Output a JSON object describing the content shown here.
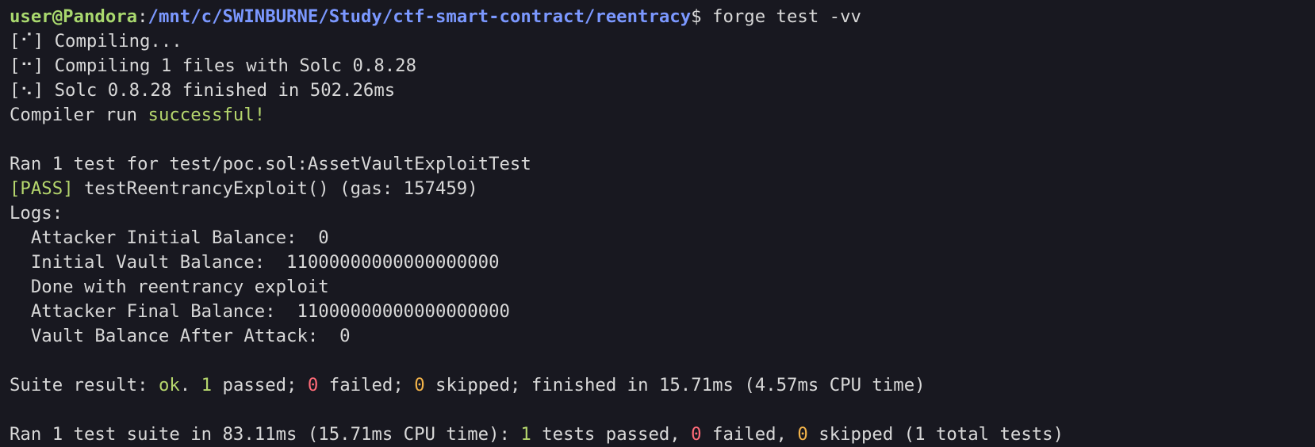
{
  "prompt": {
    "user": "user@Pandora",
    "sep": ":",
    "path": "/mnt/c/SWINBURNE/Study/ctf-smart-contract/reentracy",
    "symbol": "$",
    "command": " forge test -vv"
  },
  "compile": {
    "spin1": "[⠊]",
    "text1": " Compiling...",
    "spin2": "[⠒]",
    "text2": " Compiling 1 files with Solc 0.8.28",
    "spin3": "[⠢]",
    "text3": " Solc 0.8.28 finished in 502.26ms",
    "success_prefix": "Compiler run ",
    "success_word": "successful!"
  },
  "test": {
    "ran_line": "Ran 1 test for test/poc.sol:AssetVaultExploitTest",
    "pass_tag": "[PASS]",
    "pass_text": " testReentrancyExploit() (gas: 157459)",
    "logs_label": "Logs:",
    "logs": [
      "  Attacker Initial Balance:  0",
      "  Initial Vault Balance:  11000000000000000000",
      "  Done with reentrancy exploit",
      "  Attacker Final Balance:  11000000000000000000",
      "  Vault Balance After Attack:  0"
    ]
  },
  "suite": {
    "prefix": "Suite result: ",
    "ok": "ok",
    "dot": ". ",
    "passed_num": "1",
    "passed_text": " passed; ",
    "failed_num": "0",
    "failed_text": " failed; ",
    "skipped_num": "0",
    "skipped_text": " skipped; finished in 15.71ms (4.57ms CPU time)"
  },
  "summary": {
    "prefix": "Ran 1 test suite in 83.11ms (15.71ms CPU time): ",
    "passed_num": "1",
    "passed_text": " tests passed, ",
    "failed_num": "0",
    "failed_text": " failed, ",
    "skipped_num": "0",
    "skipped_text": " skipped (1 total tests)"
  },
  "colors": {
    "background": "#181820",
    "text": "#d8d8d8",
    "user": "#a9d86e",
    "path": "#7b98ff",
    "success": "#b5d66d",
    "fail": "#ff6b78",
    "skip": "#f2b34a"
  }
}
